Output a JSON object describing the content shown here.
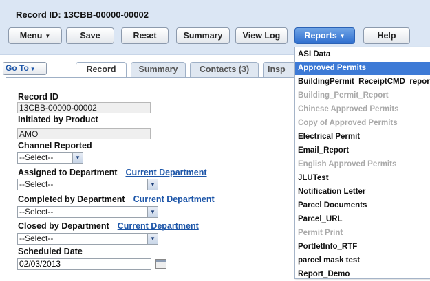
{
  "header": {
    "record_title": "Record ID: 13CBB-00000-00002",
    "buttons": {
      "menu": "Menu",
      "save": "Save",
      "reset": "Reset",
      "summary": "Summary",
      "view_log": "View Log",
      "reports": "Reports",
      "help": "Help"
    }
  },
  "tabs": {
    "goto": "Go To",
    "record": "Record",
    "summary": "Summary",
    "contacts": "Contacts (3)",
    "insp": "Insp"
  },
  "form": {
    "record_id_label": "Record ID",
    "record_id_value": "13CBB-00000-00002",
    "initiated_label": "Initiated by Product",
    "initiated_value": "AMO",
    "channel_label": "Channel Reported",
    "channel_value": "--Select--",
    "assigned_label": "Assigned to Department",
    "assigned_link": "Current Department",
    "assigned_value": "--Select--",
    "completed_label": "Completed by Department",
    "completed_link": "Current Department",
    "completed_value": "--Select--",
    "closed_label": "Closed by Department",
    "closed_link": "Current Department",
    "closed_value": "--Select--",
    "scheduled_label": "Scheduled Date",
    "scheduled_value": "02/03/2013"
  },
  "reports_menu": {
    "items": [
      {
        "label": "ASI Data",
        "state": "enabled"
      },
      {
        "label": "Approved Permits",
        "state": "highlighted"
      },
      {
        "label": "BuildingPermit_ReceiptCMD_report",
        "state": "enabled"
      },
      {
        "label": "Building_Permit_Report",
        "state": "disabled"
      },
      {
        "label": "Chinese Approved Permits",
        "state": "disabled"
      },
      {
        "label": "Copy of Approved Permits",
        "state": "disabled"
      },
      {
        "label": "Electrical Permit",
        "state": "enabled"
      },
      {
        "label": "Email_Report",
        "state": "enabled"
      },
      {
        "label": "English Approved Permits",
        "state": "disabled"
      },
      {
        "label": "JLUTest",
        "state": "enabled"
      },
      {
        "label": "Notification Letter",
        "state": "enabled"
      },
      {
        "label": "Parcel Documents",
        "state": "enabled"
      },
      {
        "label": "Parcel_URL",
        "state": "enabled"
      },
      {
        "label": "Permit Print",
        "state": "disabled"
      },
      {
        "label": "PortletInfo_RTF",
        "state": "enabled"
      },
      {
        "label": "parcel mask test",
        "state": "enabled"
      },
      {
        "label": "Report_Demo",
        "state": "enabled"
      }
    ]
  },
  "colors": {
    "header_bg": "#dbe6f4",
    "accent": "#3d7ad6",
    "link": "#1c55a8",
    "disabled": "#a9a9a9"
  }
}
